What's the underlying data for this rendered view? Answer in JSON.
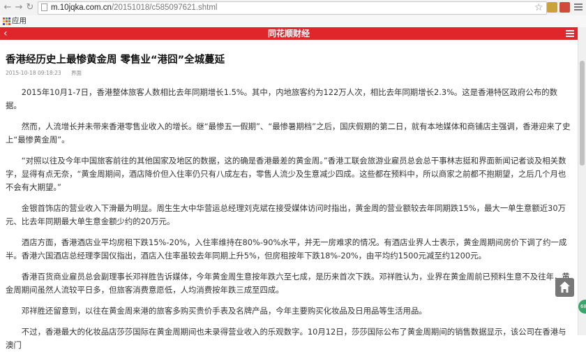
{
  "browser": {
    "url_host": "m.10jqka.com.cn",
    "url_path": "/20151018/c585097621.shtml",
    "bookmark_apps_label": "应用",
    "back_glyph": "←",
    "forward_glyph": "→",
    "reload_glyph": "↻",
    "star_glyph": "☆"
  },
  "site": {
    "brand": "同花顺财经",
    "back_glyph": "‹"
  },
  "article": {
    "title": "香港经历史上最惨黄金周 零售业“港囧”全城蔓延",
    "date": "2015-10-18 09:18:23",
    "source": "界面",
    "paragraphs": [
      "2015年10月1-7日，香港整体旅客人数相比去年同期增长1.5%。其中，内地旅客约为122万人次，相比去年同期增长2.3%。这是香港特区政府公布的数据。",
      "然而，人流增长并未带来香港零售业收入的增长。继“最惨五一假期”、“最惨暑期档”之后，国庆假期的第二日，就有本地媒体和商铺店主强调，香港迎来了史上“最惨黄金周”。",
      "“对照以往及今年中国旅客前往的其他国家及地区的数据，这的确是香港最差的黄金周。”香港工联会旅游业雇员总会总干事林志挺和界面新闻记者谈及相关数字，显得有点无奈，“黄金周期间，酒店降价但入住率仍只有八成左右，零售人流少及生意减少四成。这些都在预料中，所以商家之前都不抱期望，之后几个月也不会有大期望。”",
      "金银首饰店的营业收入下滑最为明显。周生生大中华营运总经理刘克斌在接受媒体访问时指出，黄金周的营业额较去年同期跌15%，最大一单生意额近30万元、比去年同期最大单生意金额少约的20万元。",
      "酒店方面，香港酒店业平均房租下跌15%-20%，入住率维持在80%-90%水平，并无一房难求的情况。有酒店业界人士表示，黄金周期间房价下调了约一成半。香港六国酒店总经理李国仪指出，酒店入住率虽较去年同期上升5%，但房租按年下跌18%-20%，由平均约1500元减至约1200元。",
      "香港百货商业雇员总会副理事长邓祥胜告诉媒体，今年黄金周生意按年跌六至七成，是历来首次下跌。邓祥胜认为，业界在黄金周前已预料生意不及往年，黄金周期间虽然人流较平日多，但旅客消费意愿低，人均消费按年跌三成至四成。",
      "邓祥胜还留意到，以往在黄金周来港的旅客多购买贵价手表及名牌产品，今年主要购买化妆品及日用品等生活用品。",
      "不过，香港最大的化妆品店莎莎国际在黄金周期间也未录得营业收入的乐观数字。10月12日，莎莎国际公布了黄金周期间的销售数据显示，该公司在香港与澳门"
    ]
  },
  "widgets": {
    "side_badge": "68"
  },
  "colors": {
    "brand_red": "#e0262b",
    "text": "#333333",
    "meta": "#888888"
  }
}
